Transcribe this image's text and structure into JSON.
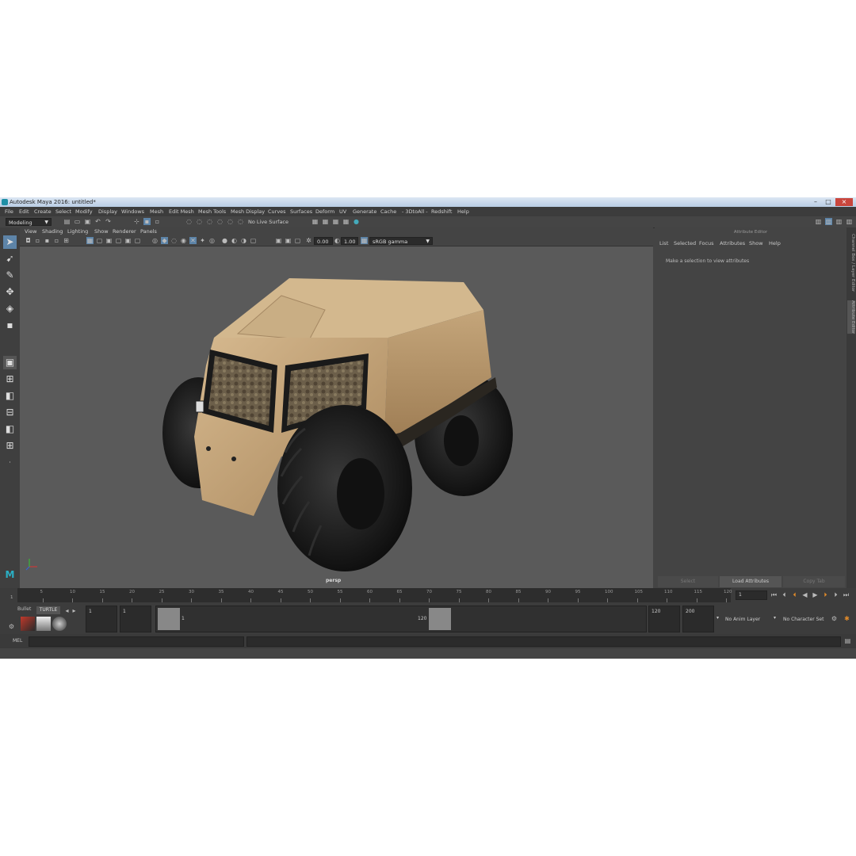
{
  "window": {
    "title": "Autodesk Maya 2016: untitled*"
  },
  "menu": [
    "File",
    "Edit",
    "Create",
    "Select",
    "Modify",
    "Display",
    "Windows",
    "Mesh",
    "Edit Mesh",
    "Mesh Tools",
    "Mesh Display",
    "Curves",
    "Surfaces",
    "Deform",
    "UV",
    "Generate",
    "Cache",
    "- 3DtoAll -",
    "Redshift",
    "Help"
  ],
  "statusline": {
    "workspace": "Modeling",
    "live_surface": "No Live Surface"
  },
  "viewport": {
    "menu": [
      "View",
      "Shading",
      "Lighting",
      "Show",
      "Renderer",
      "Panels"
    ],
    "field1": "0.00",
    "field2": "1.00",
    "color_space": "sRGB gamma",
    "camera_label": "persp"
  },
  "attribute_editor": {
    "header": "Attribute Editor",
    "tabs": [
      "List",
      "Selected",
      "Focus",
      "Attributes",
      "Show",
      "Help"
    ],
    "message": "Make a selection to view attributes",
    "buttons": [
      "Select",
      "Load Attributes",
      "Copy Tab"
    ]
  },
  "side_tabs": [
    "Channel Box / Layer Editor",
    "Attribute Editor"
  ],
  "timeslider": {
    "ticks": [
      "5",
      "10",
      "15",
      "20",
      "25",
      "30",
      "35",
      "40",
      "45",
      "50",
      "55",
      "60",
      "65",
      "70",
      "75",
      "80",
      "85",
      "90",
      "95",
      "100",
      "105",
      "110",
      "115",
      "120"
    ],
    "first": "1",
    "current_frame": "1"
  },
  "shelf": {
    "tabs": [
      "Bullet",
      "TURTLE"
    ]
  },
  "range": {
    "start": "1",
    "playback_start": "1",
    "slider_start": "1",
    "slider_end": "120",
    "playback_end": "120",
    "end": "200",
    "anim_layer": "No Anim Layer",
    "character_set": "No Character Set"
  },
  "cmdline": {
    "label": "MEL"
  },
  "colors": {
    "vehicle_body": "#c4a57a",
    "viewport_bg": "#5a5a5a",
    "ui_bg": "#444444"
  }
}
